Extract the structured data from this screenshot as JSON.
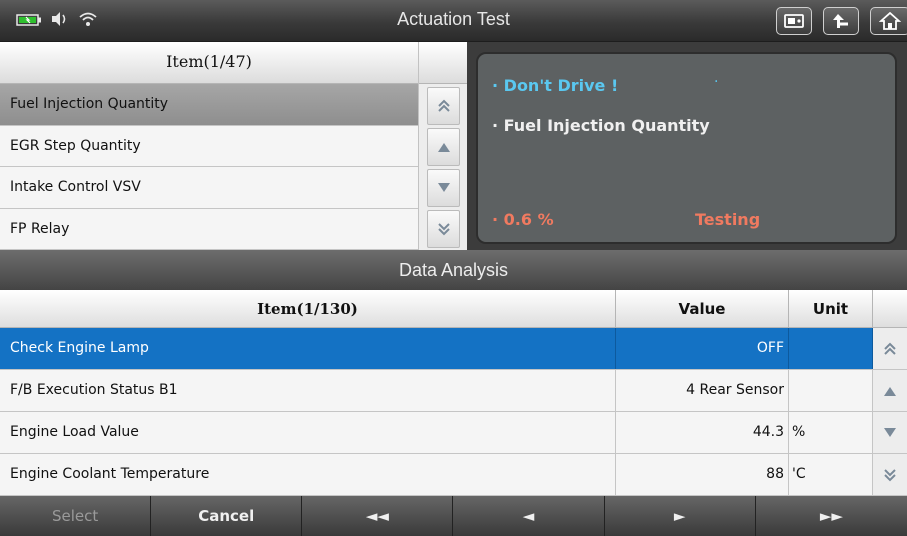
{
  "app": {
    "title": "Actuation Test"
  },
  "status_icons": [
    "battery-icon",
    "speaker-icon",
    "wifi-icon"
  ],
  "title_buttons": [
    "screenshot-icon",
    "back-arrow-icon",
    "home-icon"
  ],
  "actuation_list": {
    "header": "Item(1/47)",
    "items": [
      {
        "label": "Fuel Injection Quantity",
        "selected": true
      },
      {
        "label": "EGR Step Quantity",
        "selected": false
      },
      {
        "label": "Intake Control VSV",
        "selected": false
      },
      {
        "label": "FP Relay",
        "selected": false
      }
    ]
  },
  "status_panel": {
    "warning": "Don't Drive !",
    "item": "Fuel Injection Quantity",
    "value": "0.6 %",
    "state": "Testing"
  },
  "section_title": "Data Analysis",
  "data_table": {
    "headers": {
      "item": "Item(1/130)",
      "value": "Value",
      "unit": "Unit"
    },
    "rows": [
      {
        "name": "Check Engine Lamp",
        "value": "OFF",
        "unit": "",
        "selected": true
      },
      {
        "name": "F/B Execution Status B1",
        "value": "4 Rear Sensor",
        "unit": "",
        "selected": false
      },
      {
        "name": "Engine Load Value",
        "value": "44.3",
        "unit": "%",
        "selected": false
      },
      {
        "name": "Engine Coolant Temperature",
        "value": "88",
        "unit": "'C",
        "selected": false
      }
    ]
  },
  "toolbar": {
    "select": "Select",
    "cancel": "Cancel",
    "first": "◄◄",
    "prev": "◄",
    "next": "►",
    "last": "►►"
  },
  "colors": {
    "accent": "#1472c4",
    "warning": "#5ac8f0",
    "value": "#f07a60"
  }
}
